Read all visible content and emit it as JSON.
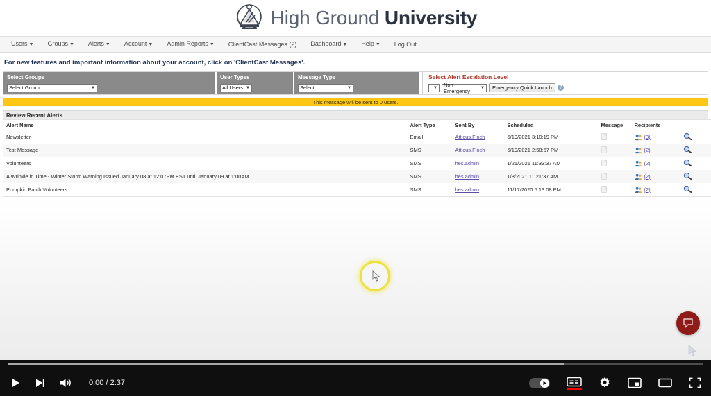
{
  "brand": {
    "logo_icon": "university-crest-icon",
    "name_light": "High Ground",
    "name_bold": "University"
  },
  "nav": {
    "items": [
      {
        "label": "Users",
        "has_caret": true
      },
      {
        "label": "Groups",
        "has_caret": true
      },
      {
        "label": "Alerts",
        "has_caret": true
      },
      {
        "label": "Account",
        "has_caret": true
      },
      {
        "label": "Admin Reports",
        "has_caret": true
      },
      {
        "label": "ClientCast Messages (2)",
        "has_caret": false
      },
      {
        "label": "Dashboard",
        "has_caret": true
      },
      {
        "label": "Help",
        "has_caret": true
      },
      {
        "label": "Log Out",
        "has_caret": false
      }
    ]
  },
  "announcement": {
    "text": "For new features and important information about your account, click on 'ClientCast Messages'."
  },
  "filters": {
    "select_groups": {
      "label": "Select Groups",
      "value": "Select Group"
    },
    "user_types": {
      "label": "User Types",
      "value": "All Users"
    },
    "message_type": {
      "label": "Message Type",
      "value": "Select..."
    },
    "escalation": {
      "label": "Select Alert Escalation Level",
      "prefix_value": "",
      "level_value": "Non-Emergency",
      "quick_launch_label": "Emergency Quick Launch",
      "help_glyph": "?"
    }
  },
  "notice": {
    "text": "This message will be sent to 0 users."
  },
  "review": {
    "panel_title": "Review Recent Alerts",
    "columns": [
      "Alert Name",
      "Alert Type",
      "Sent By",
      "Scheduled",
      "Message",
      "Recipients",
      ""
    ],
    "rows": [
      {
        "alert_name": "Newsletter",
        "alert_type": "Email",
        "sent_by": "Atticus.Finch",
        "scheduled": "5/19/2021 3:10:19 PM",
        "recipients": "(3)"
      },
      {
        "alert_name": "Test Message",
        "alert_type": "SMS",
        "sent_by": "Atticus.Finch",
        "scheduled": "5/19/2021 2:58:57 PM",
        "recipients": "(2)"
      },
      {
        "alert_name": "Volunteers",
        "alert_type": "SMS",
        "sent_by": "hes.admin",
        "scheduled": "1/21/2021 11:33:37 AM",
        "recipients": "(2)"
      },
      {
        "alert_name": "A Wrinkle in Time - Winter Storm Warning Issued January 08 at 12:07PM EST until January 09 at 1:00AM",
        "alert_type": "SMS",
        "sent_by": "hes.admin",
        "scheduled": "1/8/2021 11:21:37 AM",
        "recipients": "(2)"
      },
      {
        "alert_name": "Pumpkin Patch Volunteers",
        "alert_type": "SMS",
        "sent_by": "hes.admin",
        "scheduled": "11/17/2020 6:13:08 PM",
        "recipients": "(2)"
      }
    ]
  },
  "help_widget": {
    "icon": "chat-bubble-icon"
  },
  "player": {
    "current_time": "0:00",
    "duration": "2:37",
    "time_display": "0:00 / 2:37",
    "played_percent": 0,
    "buffered_percent": 80,
    "controls": {
      "play": "play-icon",
      "next": "next-video-icon",
      "volume": "volume-icon",
      "autoplay": "autoplay-toggle",
      "captions": "closed-captions-icon",
      "settings": "settings-gear-icon",
      "miniplayer": "miniplayer-icon",
      "theater": "theater-mode-icon",
      "fullscreen": "fullscreen-icon"
    },
    "captions_active": true
  }
}
